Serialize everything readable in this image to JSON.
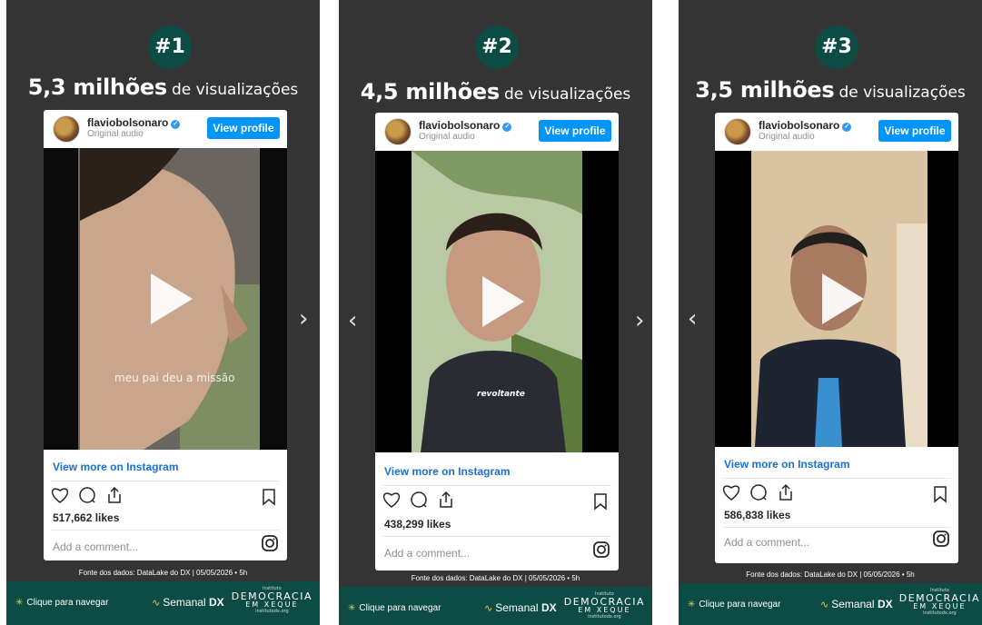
{
  "header": {
    "cut_title": "(...) ... ... ... ... ... ... ..."
  },
  "panels": [
    {
      "rank": "#1",
      "views_number": "5,3 milhões",
      "views_unit": "de visualizações",
      "username": "flaviobolsonaro",
      "audio": "Original audio",
      "view_profile": "View profile",
      "overlay_text": "meu pai deu a missão",
      "view_more": "View more on Instagram",
      "likes": "517,662 likes",
      "comment_placeholder": "Add a comment...",
      "source": "Fonte dos dados: DataLake do DX | 05/05/2026 • 5h",
      "nav_hint": "Clique para navegar",
      "semanal": "Semanal",
      "semanal_dx": "DX",
      "logo_top": "Instituto",
      "logo_main": "DEMOCRACIA",
      "logo_sub": "EM XEQUE",
      "logo_url": "institutodx.org"
    },
    {
      "rank": "#2",
      "views_number": "4,5 milhões",
      "views_unit": "de visualizações",
      "username": "flaviobolsonaro",
      "audio": "Original audio",
      "view_profile": "View profile",
      "overlay_text": "revoltante",
      "view_more": "View more on Instagram",
      "likes": "438,299 likes",
      "comment_placeholder": "Add a comment...",
      "source": "Fonte dos dados: DataLake do DX | 05/05/2026 • 5h",
      "nav_hint": "Clique para navegar",
      "semanal": "Semanal",
      "semanal_dx": "DX",
      "logo_top": "Instituto",
      "logo_main": "DEMOCRACIA",
      "logo_sub": "EM XEQUE",
      "logo_url": "institutodx.org"
    },
    {
      "rank": "#3",
      "views_number": "3,5 milhões",
      "views_unit": "de visualizações",
      "username": "flaviobolsonaro",
      "audio": "Original audio",
      "view_profile": "View profile",
      "overlay_text": "",
      "view_more": "View more on Instagram",
      "likes": "586,838 likes",
      "comment_placeholder": "Add a comment...",
      "source": "Fonte dos dados: DataLake do DX | 05/05/2026 • 5h",
      "nav_hint": "Clique para navegar",
      "semanal": "Semanal",
      "semanal_dx": "DX",
      "logo_top": "Instituto",
      "logo_main": "DEMOCRACIA",
      "logo_sub": "EM XEQUE",
      "logo_url": "institutodx.org"
    }
  ],
  "icons": {
    "arrow_left": "‹",
    "arrow_right": "›",
    "spark": "✳"
  },
  "colors": {
    "panel_bg": "#343434",
    "brand_green": "#0d4b45",
    "instagram_blue": "#0095f6"
  }
}
